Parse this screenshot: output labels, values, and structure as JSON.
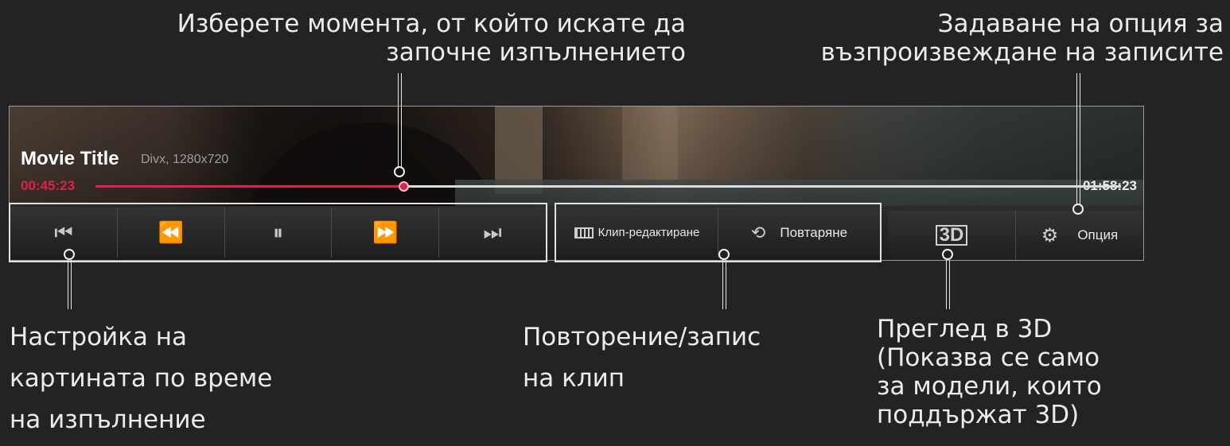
{
  "callouts": {
    "seek": [
      "Изберете момента, от който искате да",
      "започне изпълнението"
    ],
    "option": [
      "Задаване на опция за",
      "възпроизвеждане на записите"
    ],
    "picture": [
      "Настройка на",
      "картината по време",
      "на изпълнение"
    ],
    "repeat_clip": [
      "Повторение/запис",
      "на клип"
    ],
    "view3d": [
      "Преглед в 3D",
      "(Показва се само",
      "за модели, които",
      "поддържат 3D)"
    ]
  },
  "player": {
    "title": "Movie Title",
    "meta": "Divx, 1280x720",
    "current_time": "00:45:23",
    "total_time": "01:58:23",
    "progress": 0.3
  },
  "controls": {
    "transport": [
      {
        "name": "skip-previous-icon",
        "glyph": "⏮"
      },
      {
        "name": "rewind-icon",
        "glyph": "⏪"
      },
      {
        "name": "pause-icon",
        "glyph": "⏸"
      },
      {
        "name": "fast-forward-icon",
        "glyph": "⏩"
      },
      {
        "name": "skip-next-icon",
        "glyph": "⏭"
      }
    ],
    "clip_edit_label": "Клип-редактиране",
    "repeat_label": "Повтаряне",
    "three_d_label": "3D",
    "option_label": "Опция"
  },
  "colors": {
    "accent": "#e0204e",
    "background": "#232323"
  }
}
